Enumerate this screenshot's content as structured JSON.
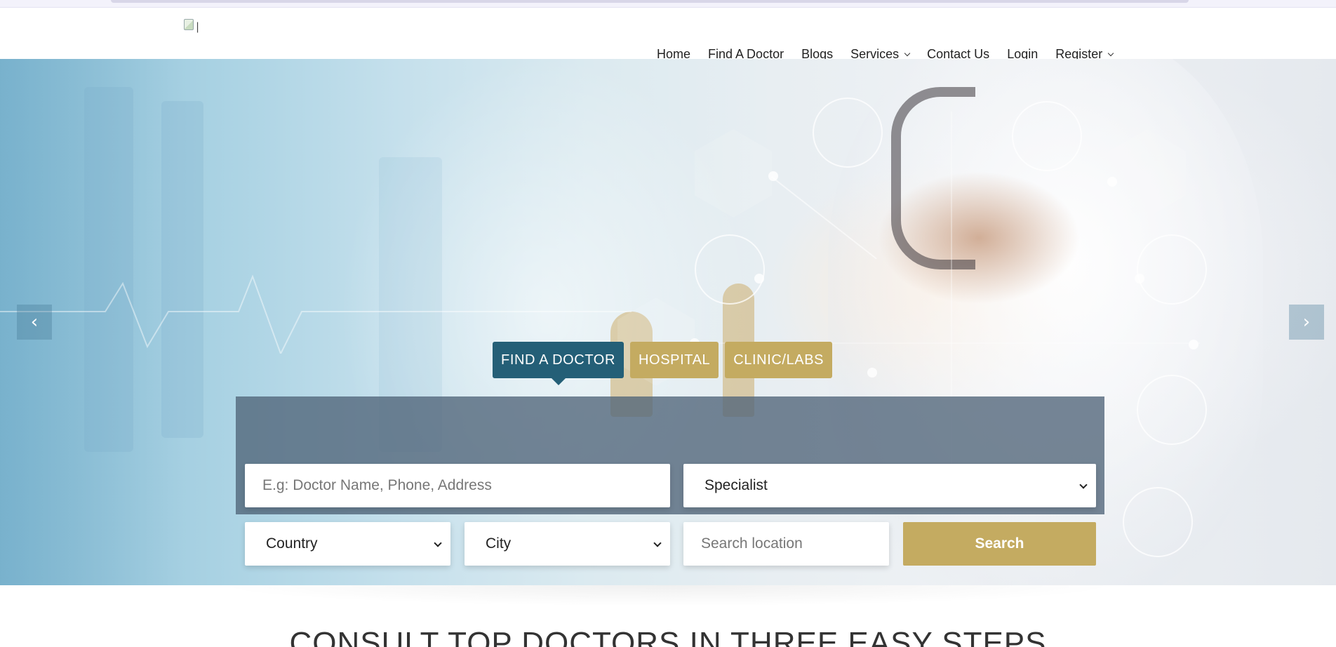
{
  "header": {
    "logo_alt": "|",
    "nav": [
      {
        "label": "Home",
        "has_dropdown": false
      },
      {
        "label": "Find A Doctor",
        "has_dropdown": false
      },
      {
        "label": "Blogs",
        "has_dropdown": false
      },
      {
        "label": "Services",
        "has_dropdown": true
      },
      {
        "label": "Contact Us",
        "has_dropdown": false
      },
      {
        "label": "Login",
        "has_dropdown": false
      },
      {
        "label": "Register",
        "has_dropdown": true
      }
    ]
  },
  "hero": {
    "arrow_prev": "‹",
    "arrow_next": "›"
  },
  "tabs": [
    {
      "label": "FIND A DOCTOR",
      "active": true
    },
    {
      "label": "HOSPITAL",
      "active": false
    },
    {
      "label": "CLINIC/LABS",
      "active": false
    }
  ],
  "search": {
    "query_placeholder": "E.g: Doctor Name, Phone, Address",
    "specialist_value": "Specialist",
    "country_value": "Country",
    "city_value": "City",
    "location_placeholder": "Search location",
    "button_label": "Search"
  },
  "section": {
    "title": "CONSULT TOP DOCTORS IN THREE EASY STEPS"
  },
  "colors": {
    "primary_teal": "#245f77",
    "accent_gold": "#c4ab61"
  }
}
